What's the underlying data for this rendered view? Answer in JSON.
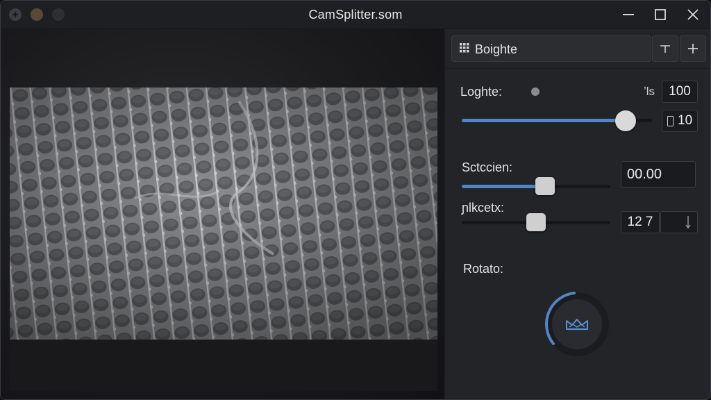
{
  "window": {
    "title": "CamSplitter.som",
    "controls": {
      "minimize_icon": "minimize-icon",
      "maximize_icon": "maximize-icon",
      "close_icon": "close-icon"
    }
  },
  "panel": {
    "preset": {
      "icon": "grid-icon",
      "label": "Boighte"
    },
    "preset_buttons": [
      {
        "icon": "tee-icon"
      },
      {
        "icon": "plus-icon"
      }
    ],
    "brightness": {
      "label": "Loghte:",
      "unit": "ʼls",
      "value": "100",
      "secondary_value": "10",
      "level": 0.86
    },
    "saturation": {
      "label": "Sctccien:",
      "value": "00.00",
      "level": 0.56
    },
    "contrast": {
      "label": "ɲlkcetx:",
      "value": "12 7",
      "level": 0.5
    },
    "rotate": {
      "label": "Rotato:",
      "icon": "crown-icon"
    }
  },
  "colors": {
    "accent": "#4f86c6",
    "background": "#1b1c1f",
    "panel": "#232428"
  }
}
